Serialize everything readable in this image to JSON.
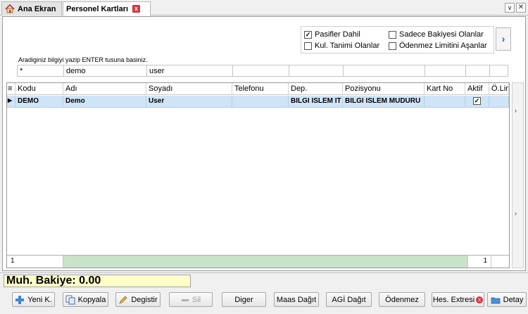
{
  "tabs": [
    {
      "label": "Ana Ekran"
    },
    {
      "label": "Personel Kartları"
    }
  ],
  "tab_dropdown_glyph": "∨",
  "tab_close_glyph": "x",
  "options": {
    "pasifler_dahil": {
      "label": "Pasifler Dahil",
      "checked": true
    },
    "sadece_bakiyesi": {
      "label": "Sadece Bakiyesi Olanlar",
      "checked": false
    },
    "kul_tanimi": {
      "label": "Kul. Tanimi Olanlar",
      "checked": false
    },
    "odenmez_limit": {
      "label": "Ödenmez Limitini Aşanlar",
      "checked": false
    }
  },
  "next_glyph": "›",
  "hint": "Aradiginiz bilgiyi yazip ENTER tusuna basiniz.",
  "filters": [
    "*",
    "demo",
    "user",
    "",
    "",
    "",
    "",
    "",
    ""
  ],
  "grid": {
    "columns": [
      "Kodu",
      "Adı",
      "Soyadı",
      "Telefonu",
      "Dep.",
      "Pozisyonu",
      "Kart No",
      "Aktif",
      "Ö.Lim"
    ],
    "rows": [
      {
        "kodu": "DEMO",
        "adi": "Demo",
        "soyadi": "User",
        "telefonu": "",
        "dep": "BILGI ISLEM IT",
        "pozisyonu": "BILGI ISLEM MUDURU",
        "kart_no": "",
        "aktif": true,
        "olim": ""
      }
    ],
    "footer_left": "1",
    "footer_right": "1"
  },
  "balance": "Muh. Bakiye: 0.00",
  "buttons": {
    "yeni": "Yeni K.",
    "kopyala": "Kopyala",
    "degistir": "Degistir",
    "sil": "Sil",
    "diger": "Diger",
    "maas": "Maas Dağıt",
    "agi": "AGİ Dağıt",
    "odenmez": "Ödenmez",
    "hes_ekstresi": "Hes. Extresi",
    "detay": "Detay"
  },
  "colors": {
    "selected_row": "#cfe4f7",
    "balance_bg": "#ffffc8",
    "accent": "#1565c0"
  },
  "icons": [
    "home-icon",
    "close-icon",
    "chevron-down-icon",
    "chevron-right-icon",
    "plus-icon",
    "copy-icon",
    "edit-icon",
    "minus-icon",
    "folder-icon"
  ]
}
